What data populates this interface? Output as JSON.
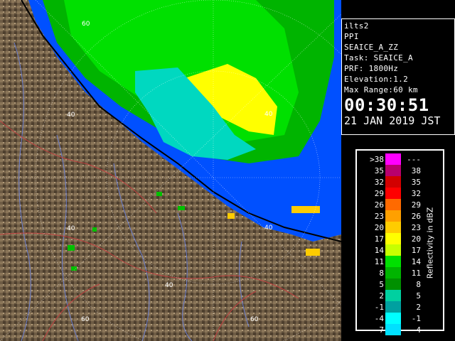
{
  "info": {
    "station": "ilts2",
    "product": "PPI",
    "scan": "SEAICE_A_ZZ",
    "task": "Task: SEAICE_A",
    "prf": "PRF: 1800Hz",
    "elevation": "Elevation:1.2",
    "max_range": "Max Range:60 km",
    "time": "00:30:51",
    "date": "21 JAN 2019 JST"
  },
  "legend": {
    "title": "Reflectivity in dBZ",
    "rows": [
      {
        "lo": ">38",
        "hi": "---",
        "color": "#ff00ff"
      },
      {
        "lo": "35",
        "hi": "38",
        "color": "#b8006e"
      },
      {
        "lo": "32",
        "hi": "35",
        "color": "#d20000"
      },
      {
        "lo": "29",
        "hi": "32",
        "color": "#ff0000"
      },
      {
        "lo": "26",
        "hi": "29",
        "color": "#ff6a00"
      },
      {
        "lo": "23",
        "hi": "26",
        "color": "#ffa000"
      },
      {
        "lo": "20",
        "hi": "23",
        "color": "#ffcc00"
      },
      {
        "lo": "17",
        "hi": "20",
        "color": "#ffff00"
      },
      {
        "lo": "14",
        "hi": "17",
        "color": "#c8ff00"
      },
      {
        "lo": "11",
        "hi": "14",
        "color": "#00e000"
      },
      {
        "lo": "8",
        "hi": "11",
        "color": "#00b400"
      },
      {
        "lo": "5",
        "hi": "8",
        "color": "#009000"
      },
      {
        "lo": "2",
        "hi": "5",
        "color": "#00d0a0"
      },
      {
        "lo": "-1",
        "hi": "2",
        "color": "#00a0a0"
      },
      {
        "lo": "-4",
        "hi": "-1",
        "color": "#00ffff"
      },
      {
        "lo": "-7",
        "hi": "-4",
        "color": "#00e0ff"
      }
    ]
  },
  "range_labels": {
    "n60": "60",
    "nw40": "40",
    "ne40": "40",
    "w40": "40",
    "e40": "40",
    "s40": "40",
    "sw60": "60",
    "se60": "60"
  },
  "colors": {
    "land": "#6b5a44",
    "sea_echo": "#0050ff",
    "weak_echo": "#00d8c0",
    "moderate_echo": "#00c000",
    "strong_echo": "#ffff00"
  }
}
